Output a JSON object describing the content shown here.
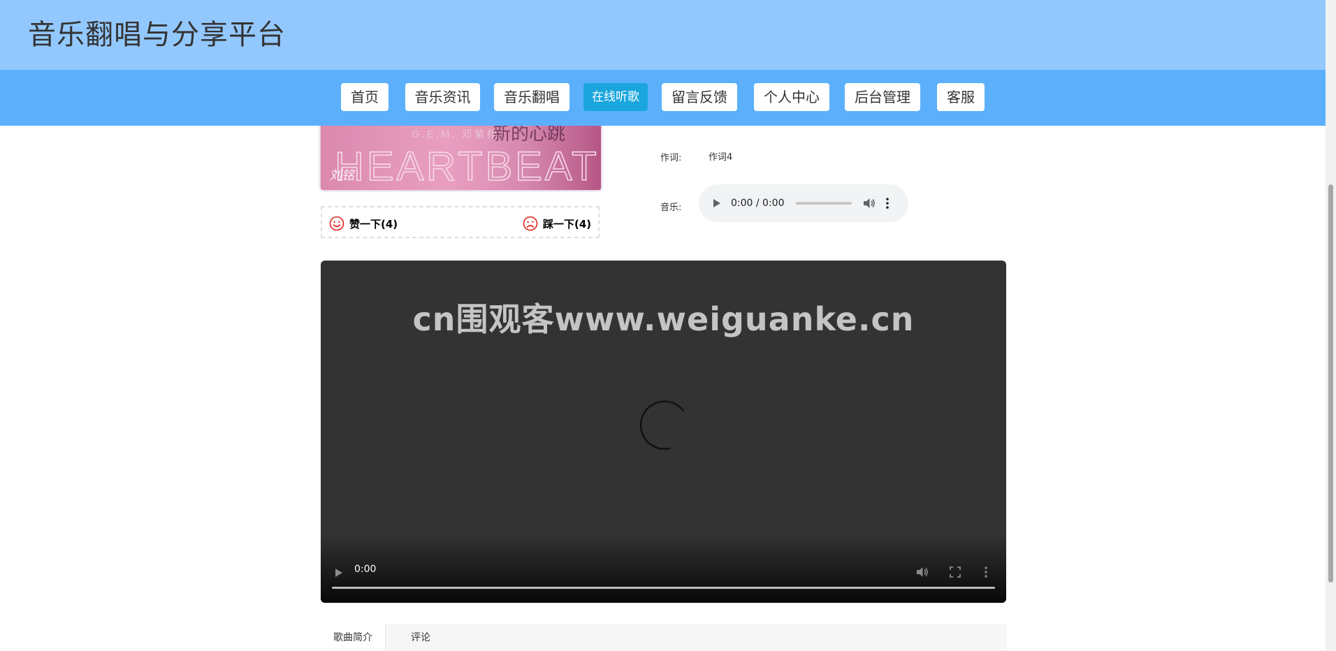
{
  "header": {
    "site_title": "音乐翻唱与分享平台"
  },
  "nav": {
    "items": [
      {
        "label": "首页"
      },
      {
        "label": "音乐资讯"
      },
      {
        "label": "音乐翻唱"
      },
      {
        "label": "在线听歌",
        "active": true
      },
      {
        "label": "留言反馈"
      },
      {
        "label": "个人中心"
      },
      {
        "label": "后台管理"
      },
      {
        "label": "客服"
      }
    ]
  },
  "album": {
    "artist_text": "G.E.M. 邓紫棋",
    "song_title_cn": "新的心跳",
    "song_title_en": "HEARTBEAT",
    "signature": "刘铭"
  },
  "votes": {
    "like_label": "赞一下(4)",
    "dislike_label": "踩一下(4)",
    "icon_color": "#e2231a"
  },
  "details": {
    "lyricist_label": "作词:",
    "lyricist_value": "作词4",
    "music_label": "音乐:"
  },
  "audio": {
    "time": "0:00 / 0:00"
  },
  "video": {
    "time": "0:00",
    "watermark": "cn围观客www.weiguanke.cn"
  },
  "tabs": [
    {
      "label": "歌曲简介",
      "active": true
    },
    {
      "label": "评论"
    }
  ],
  "colors": {
    "header_bg": "#93c8ff",
    "nav_bg": "#5cb0fb",
    "nav_active_bg": "#1aa6dd",
    "video_bg": "#333333"
  }
}
